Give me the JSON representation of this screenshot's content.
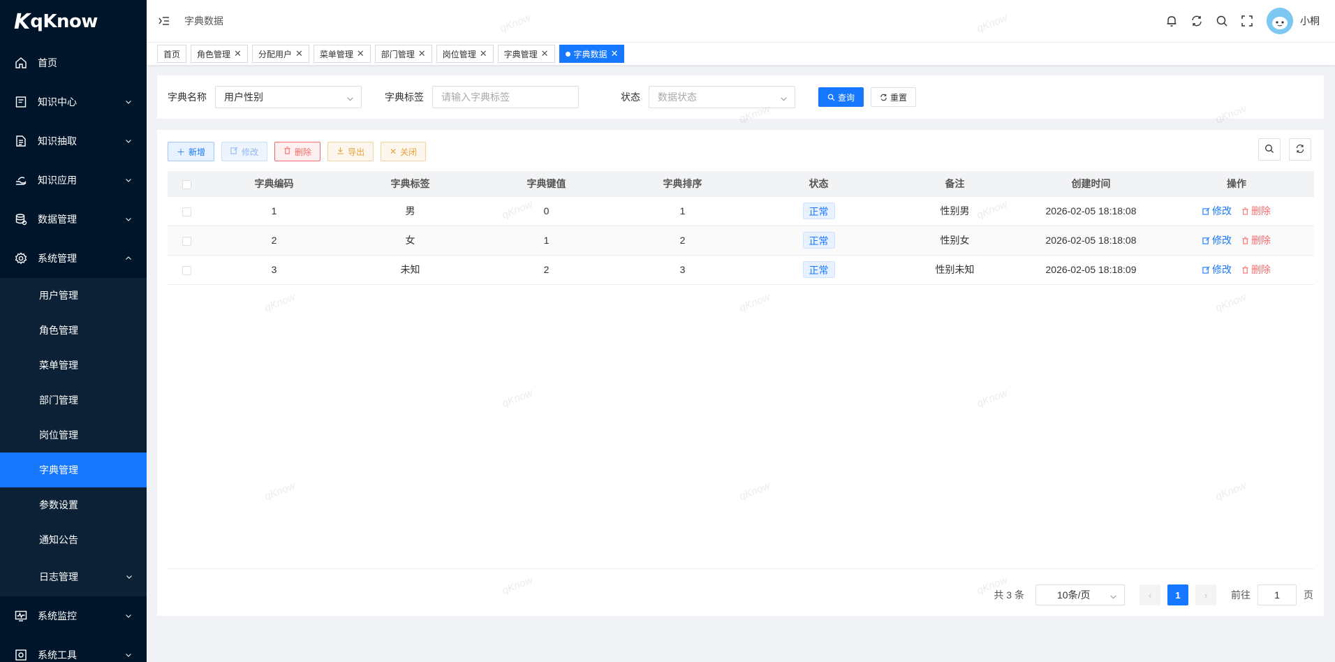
{
  "app": {
    "logo_text": "qKnow",
    "logo_mark": "K"
  },
  "sidebar": {
    "items": [
      {
        "label": "首页",
        "icon": "home-icon",
        "expandable": false
      },
      {
        "label": "知识中心",
        "icon": "book-icon",
        "expandable": true
      },
      {
        "label": "知识抽取",
        "icon": "document-icon",
        "expandable": true
      },
      {
        "label": "知识应用",
        "icon": "hand-icon",
        "expandable": true
      },
      {
        "label": "数据管理",
        "icon": "database-icon",
        "expandable": true
      },
      {
        "label": "系统管理",
        "icon": "gear-icon",
        "expandable": true,
        "expanded": true
      }
    ],
    "system_sub": [
      {
        "label": "用户管理"
      },
      {
        "label": "角色管理"
      },
      {
        "label": "菜单管理"
      },
      {
        "label": "部门管理"
      },
      {
        "label": "岗位管理"
      },
      {
        "label": "字典管理",
        "active": true
      },
      {
        "label": "参数设置"
      },
      {
        "label": "通知公告"
      },
      {
        "label": "日志管理",
        "expandable": true
      }
    ],
    "bottom_items": [
      {
        "label": "系统监控",
        "icon": "monitor-icon"
      },
      {
        "label": "系统工具",
        "icon": "tool-icon"
      }
    ]
  },
  "header": {
    "breadcrumb": "字典数据",
    "username": "小桐"
  },
  "tags": [
    {
      "label": "首页",
      "closable": false
    },
    {
      "label": "角色管理",
      "closable": true
    },
    {
      "label": "分配用户",
      "closable": true
    },
    {
      "label": "菜单管理",
      "closable": true
    },
    {
      "label": "部门管理",
      "closable": true
    },
    {
      "label": "岗位管理",
      "closable": true
    },
    {
      "label": "字典管理",
      "closable": true
    },
    {
      "label": "字典数据",
      "closable": true,
      "active": true
    }
  ],
  "search": {
    "dict_name_label": "字典名称",
    "dict_name_value": "用户性别",
    "dict_label_label": "字典标签",
    "dict_label_placeholder": "请输入字典标签",
    "status_label": "状态",
    "status_placeholder": "数据状态",
    "query_button": "查询",
    "reset_button": "重置"
  },
  "toolbar": {
    "add": "新增",
    "edit": "修改",
    "delete": "删除",
    "export": "导出",
    "close": "关闭"
  },
  "table": {
    "columns": [
      "字典编码",
      "字典标签",
      "字典键值",
      "字典排序",
      "状态",
      "备注",
      "创建时间",
      "操作"
    ],
    "rows": [
      {
        "code": "1",
        "label": "男",
        "value": "0",
        "sort": "1",
        "status": "正常",
        "remark": "性别男",
        "created": "2026-02-05 18:18:08"
      },
      {
        "code": "2",
        "label": "女",
        "value": "1",
        "sort": "2",
        "status": "正常",
        "remark": "性别女",
        "created": "2026-02-05 18:18:08"
      },
      {
        "code": "3",
        "label": "未知",
        "value": "2",
        "sort": "3",
        "status": "正常",
        "remark": "性别未知",
        "created": "2026-02-05 18:18:09"
      }
    ],
    "op_edit": "修改",
    "op_delete": "删除"
  },
  "pagination": {
    "total_text": "共 3 条",
    "page_size": "10条/页",
    "current_page": "1",
    "goto_prefix": "前往",
    "goto_value": "1",
    "goto_suffix": "页"
  },
  "watermark": "qKnow",
  "colors": {
    "primary": "#1677ff",
    "sidebar_bg": "#001529",
    "danger": "#f56c6c",
    "warning": "#e6a23c"
  }
}
